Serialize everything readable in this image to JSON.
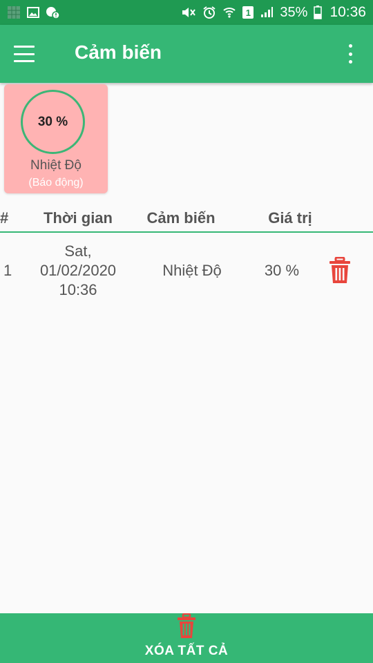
{
  "status_bar": {
    "battery_percent": "35%",
    "time": "10:36",
    "sim_label": "1",
    "icons_left": [
      "app-icon",
      "image-icon",
      "notification-icon"
    ],
    "icons_right": [
      "mute-icon",
      "alarm-icon",
      "wifi-icon",
      "sim-icon",
      "signal-icon",
      "battery-icon"
    ]
  },
  "app_bar": {
    "title": "Cảm biến",
    "menu_icon": "hamburger-menu-icon",
    "overflow_icon": "more-vert-icon"
  },
  "sensor_card": {
    "value": "30 %",
    "value_fraction": 0.3,
    "name": "Nhiệt Độ",
    "status": "(Báo động)",
    "background": "#ffb3b3",
    "ring_color": "#3cb676"
  },
  "table": {
    "headers": [
      "#",
      "Thời gian",
      "Cảm biến",
      "Giá trị"
    ],
    "rows": [
      {
        "index": "1",
        "time_lines": [
          "Sat,",
          "01/02/2020",
          "10:36"
        ],
        "sensor": "Nhiệt Độ",
        "value": "30 %",
        "action_icon": "trash-icon"
      }
    ]
  },
  "bottom_bar": {
    "label": "XÓA TẤT CẢ",
    "icon": "trash-icon"
  },
  "colors": {
    "status_bar": "#1f9a52",
    "primary": "#35b775",
    "danger": "#e8453c",
    "card_alarm": "#ffb3b3",
    "text": "#555555"
  }
}
